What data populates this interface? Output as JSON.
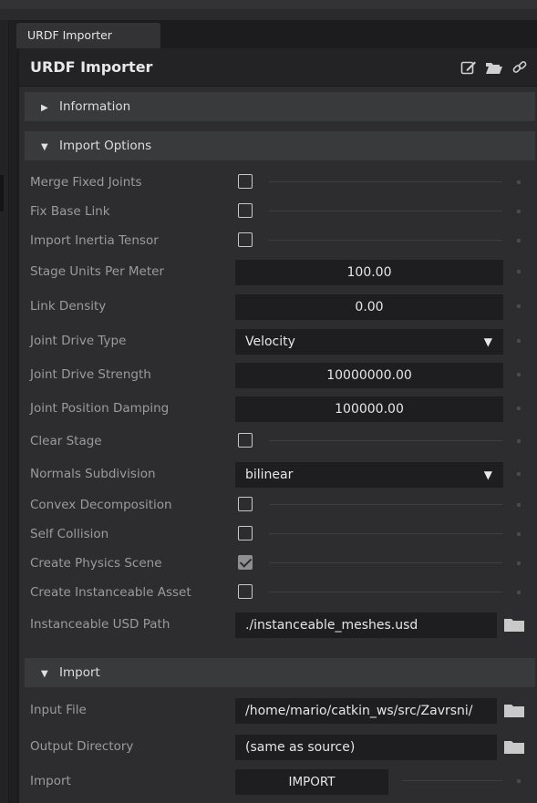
{
  "window": {
    "tab_label": "URDF Importer",
    "title": "URDF Importer"
  },
  "sections": {
    "information": {
      "label": "Information",
      "expanded": false
    },
    "import_options": {
      "label": "Import Options",
      "expanded": true
    },
    "import": {
      "label": "Import",
      "expanded": true
    }
  },
  "options": {
    "merge_fixed_joints": {
      "label": "Merge Fixed Joints",
      "checked": false
    },
    "fix_base_link": {
      "label": "Fix Base Link",
      "checked": false
    },
    "import_inertia_tensor": {
      "label": "Import Inertia Tensor",
      "checked": false
    },
    "stage_units_per_meter": {
      "label": "Stage Units Per Meter",
      "value": "100.00"
    },
    "link_density": {
      "label": "Link Density",
      "value": "0.00"
    },
    "joint_drive_type": {
      "label": "Joint Drive Type",
      "value": "Velocity"
    },
    "joint_drive_strength": {
      "label": "Joint Drive Strength",
      "value": "10000000.00"
    },
    "joint_position_damping": {
      "label": "Joint Position Damping",
      "value": "100000.00"
    },
    "clear_stage": {
      "label": "Clear Stage",
      "checked": false
    },
    "normals_subdivision": {
      "label": "Normals Subdivision",
      "value": "bilinear"
    },
    "convex_decomposition": {
      "label": "Convex Decomposition",
      "checked": false
    },
    "self_collision": {
      "label": "Self Collision",
      "checked": false
    },
    "create_physics_scene": {
      "label": "Create Physics Scene",
      "checked": true
    },
    "create_instanceable_asset": {
      "label": "Create Instanceable Asset",
      "checked": false
    },
    "instanceable_usd_path": {
      "label": "Instanceable USD Path",
      "value": "./instanceable_meshes.usd"
    }
  },
  "import": {
    "input_file": {
      "label": "Input File",
      "value": "/home/mario/catkin_ws/src/Zavrsni/"
    },
    "output_directory": {
      "label": "Output Directory",
      "value": "(same as source)"
    },
    "import_action": {
      "label": "Import",
      "button_label": "IMPORT"
    }
  },
  "icons": {
    "edit": "edit-icon",
    "folder": "folder-icon",
    "link": "link-icon"
  },
  "colors": {
    "panel": "#2d2d2f",
    "field": "#1e1e20",
    "label": "#9a9b9d",
    "section": "#393a3c"
  }
}
